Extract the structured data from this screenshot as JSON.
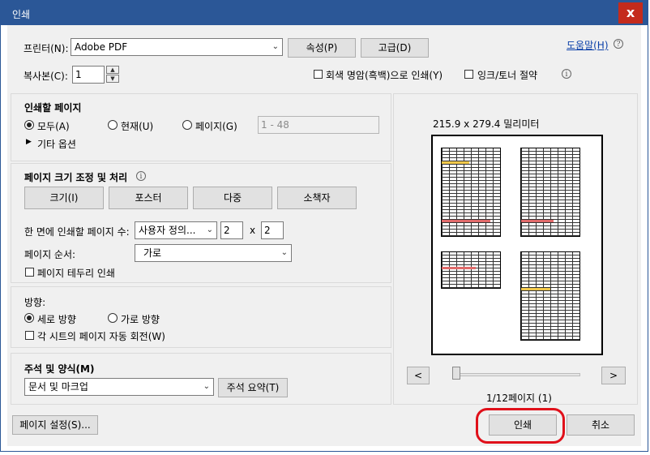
{
  "window": {
    "title": "인쇄",
    "close_glyph": "x"
  },
  "printer": {
    "label": "프린터(N):",
    "selected": "Adobe PDF",
    "properties_button": "속성(P)",
    "advanced_button": "고급(D)",
    "help_link": "도움말(H)"
  },
  "copies": {
    "label": "복사본(C):",
    "value": "1",
    "grayscale_label": "회색 명암(흑백)으로 인쇄(Y)",
    "save_ink_label": "잉크/토너 절약"
  },
  "pages_to_print": {
    "heading": "인쇄할 페이지",
    "all_label": "모두(A)",
    "current_label": "현재(U)",
    "pages_label": "페이지(G)",
    "pages_value": "1 - 48",
    "more_options": "기타 옵션"
  },
  "page_sizing": {
    "heading": "페이지 크기 조정 및 처리",
    "buttons": [
      "크기(I)",
      "포스터",
      "다중",
      "소책자"
    ],
    "per_sheet_label": "한 면에 인쇄할 페이지 수:",
    "per_sheet_selected": "사용자 정의...",
    "per_sheet_cols": "2",
    "per_sheet_x": "x",
    "per_sheet_rows": "2",
    "order_label": "페이지 순서:",
    "order_selected": "가로",
    "border_label": "페이지 테두리 인쇄"
  },
  "orientation": {
    "heading": "방향:",
    "portrait_label": "세로 방향",
    "landscape_label": "가로 방향",
    "auto_rotate_label": "각 시트의 페이지 자동 회전(W)"
  },
  "comments": {
    "heading": "주석 및 양식(M)",
    "selected": "문서 및 마크업",
    "summarize_button": "주석 요약(T)"
  },
  "preview": {
    "size_text": "215.9 x 279.4 밀리미터",
    "prev_button": "<",
    "next_button": ">",
    "page_indicator": "1/12페이지 (1)",
    "slider_fraction": 0.0
  },
  "footer": {
    "page_setup_button": "페이지 설정(S)...",
    "print_button": "인쇄",
    "cancel_button": "취소"
  },
  "colors": {
    "title_bar": "#2b5797",
    "close": "#c42b1c",
    "highlight_oval": "#e0101a",
    "link": "#0a3fa8"
  },
  "icons": {
    "info": "info-icon",
    "help": "help-icon",
    "dropdown": "chevron-down-icon",
    "expand": "triangle-right-icon"
  }
}
